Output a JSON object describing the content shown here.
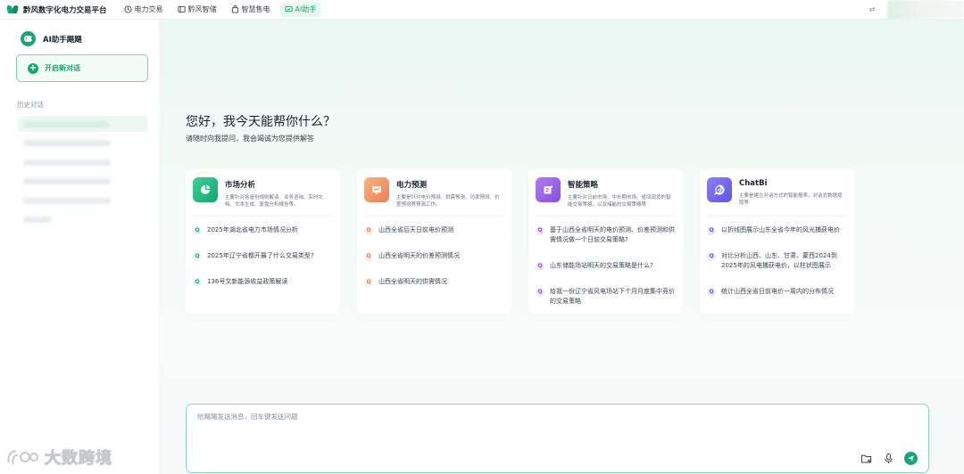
{
  "app": {
    "title": "黔风数字化电力交易平台",
    "brand_color": "#16a874"
  },
  "nav": {
    "tabs": [
      {
        "label": "电力交易",
        "icon": "trade-icon"
      },
      {
        "label": "黔风智储",
        "icon": "storage-icon"
      },
      {
        "label": "智慧售电",
        "icon": "shopping-bag-icon"
      },
      {
        "label": "AI助手",
        "icon": "ai-chat-icon",
        "active": true
      }
    ]
  },
  "sidebar": {
    "assistant_name": "AI助手飓飓",
    "new_chat_label": "开启新对话",
    "history_title": "历史对话"
  },
  "main": {
    "greeting": "您好，我今天能帮你什么？",
    "subgreeting": "请随时向我提问，我会竭诚为您提供解答",
    "cards": [
      {
        "title": "市场分析",
        "desc": "主要针对各省份规则解读、业务咨询、实时文档、文本生成、复盘分析报告等。",
        "icon": "pie-chart-icon",
        "questions": [
          "2025年湖北省电力市场情况分析",
          "2025年辽宁省都开展了什么交易类型?",
          "136号文新能源收益政策解读"
        ]
      },
      {
        "title": "电力预测",
        "desc": "主要是针对电价预测、供需预测、功率预测、价差预测等预测工作。",
        "icon": "monitor-chart-icon",
        "questions": [
          "山西全省后天日前电价预测",
          "山西全省明天的价差预测情况",
          "山西全省明天的供需情况"
        ]
      },
      {
        "title": "智能策略",
        "desc": "主要针对日前市场、中长期市场、省间现货的智能交易策略，以及储能的交易策略等",
        "icon": "strategy-icon",
        "questions": [
          "基于山西全省明天的电价预测、价差预测和供需情况做一个日前交易策略?",
          "山东储能场站明天的交易策略是什么?",
          "给我一份辽宁省风电场站下个月月度集中竞价的交易策略"
        ]
      },
      {
        "title": "ChatBi",
        "desc": "主要是建立对话方式的智能报表，对话式数据提取等",
        "icon": "chatbi-icon",
        "questions": [
          "以折线图展示山东全省今年的风光捕获电价",
          "对比分析山西、山东、甘肃、蒙西2024到2025年的风电捕获电价，以柱状图展示",
          "统计山西全省日前电价一周内的分布情况"
        ]
      }
    ]
  },
  "input": {
    "placeholder": "给飓飓发送消息，回车键发送问题"
  },
  "watermark": {
    "text": "大数跨境"
  }
}
